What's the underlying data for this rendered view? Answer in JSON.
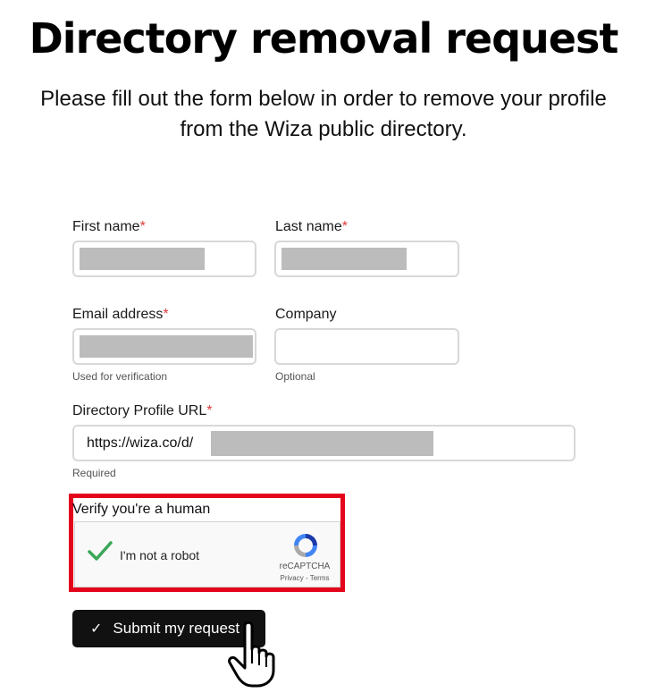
{
  "page": {
    "title": "Directory removal request",
    "subtitle_line1": "Please fill out the form below in order to remove your profile",
    "subtitle_line2": "from the Wiza public directory."
  },
  "form": {
    "first_name": {
      "label": "First name",
      "required_mark": "*"
    },
    "last_name": {
      "label": "Last name",
      "required_mark": "*"
    },
    "email": {
      "label": "Email address",
      "required_mark": "*",
      "hint": "Used for verification"
    },
    "company": {
      "label": "Company",
      "hint": "Optional",
      "value": ""
    },
    "profile_url": {
      "label": "Directory Profile URL",
      "required_mark": "*",
      "prefix": "https://wiza.co/d/",
      "hint": "Required"
    },
    "verify_label": "Verify you're a human",
    "recaptcha": {
      "text": "I'm not a robot",
      "brand": "reCAPTCHA",
      "links": "Privacy - Terms",
      "checked": true
    },
    "submit_label": "Submit my request"
  },
  "colors": {
    "required": "#e23b3b",
    "highlight_border": "#e3051b",
    "check_green": "#3aa757",
    "button_bg": "#111111"
  },
  "icons": [
    "checkmark-icon",
    "recaptcha-logo-icon",
    "submit-check-icon",
    "hand-cursor-icon"
  ]
}
